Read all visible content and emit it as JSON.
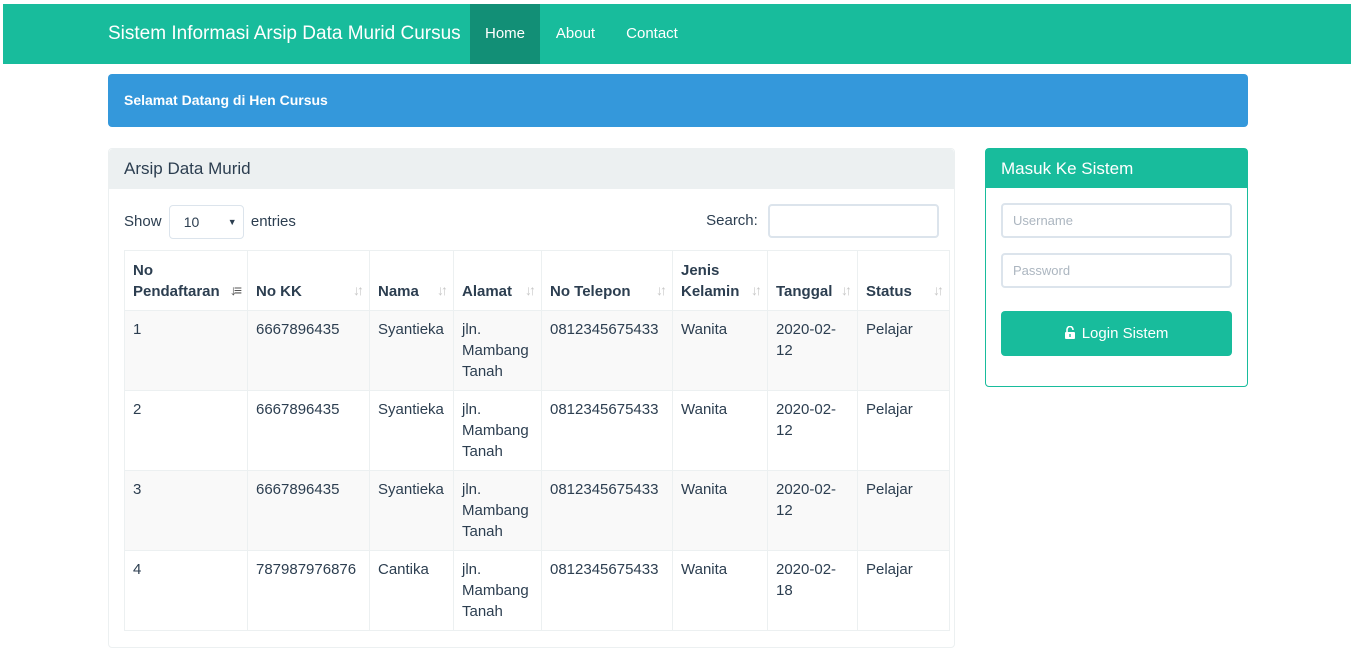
{
  "navbar": {
    "brand": "Sistem Informasi Arsip Data Murid Cursus",
    "items": [
      {
        "label": "Home",
        "active": true
      },
      {
        "label": "About",
        "active": false
      },
      {
        "label": "Contact",
        "active": false
      }
    ]
  },
  "alert": {
    "text": "Selamat Datang di Hen Cursus"
  },
  "archive": {
    "title": "Arsip Data Murid",
    "length": {
      "show_label": "Show",
      "value": "10",
      "entries_label": "entries"
    },
    "search": {
      "label": "Search:",
      "value": ""
    },
    "columns": [
      {
        "label": "No Pendaftaran",
        "sort": "asc"
      },
      {
        "label": "No KK",
        "sort": "none"
      },
      {
        "label": "Nama",
        "sort": "none"
      },
      {
        "label": "Alamat",
        "sort": "none"
      },
      {
        "label": "No Telepon",
        "sort": "none"
      },
      {
        "label": "Jenis Kelamin",
        "sort": "none"
      },
      {
        "label": "Tanggal",
        "sort": "none"
      },
      {
        "label": "Status",
        "sort": "none"
      }
    ],
    "rows": [
      [
        "1",
        "6667896435",
        "Syantieka",
        "jln. Mambang Tanah",
        "0812345675433",
        "Wanita",
        "2020-02-12",
        "Pelajar"
      ],
      [
        "2",
        "6667896435",
        "Syantieka",
        "jln. Mambang Tanah",
        "0812345675433",
        "Wanita",
        "2020-02-12",
        "Pelajar"
      ],
      [
        "3",
        "6667896435",
        "Syantieka",
        "jln. Mambang Tanah",
        "0812345675433",
        "Wanita",
        "2020-02-12",
        "Pelajar"
      ],
      [
        "4",
        "787987976876",
        "Cantika",
        "jln. Mambang Tanah",
        "0812345675433",
        "Wanita",
        "2020-02-18",
        "Pelajar"
      ]
    ]
  },
  "login": {
    "title": "Masuk Ke Sistem",
    "username_placeholder": "Username",
    "password_placeholder": "Password",
    "button_label": "Login Sistem",
    "button_icon": "unlock-icon"
  },
  "colors": {
    "primary": "#18bc9c",
    "info": "#3498db",
    "nav_active": "#128f76",
    "text": "#2c3e50"
  }
}
